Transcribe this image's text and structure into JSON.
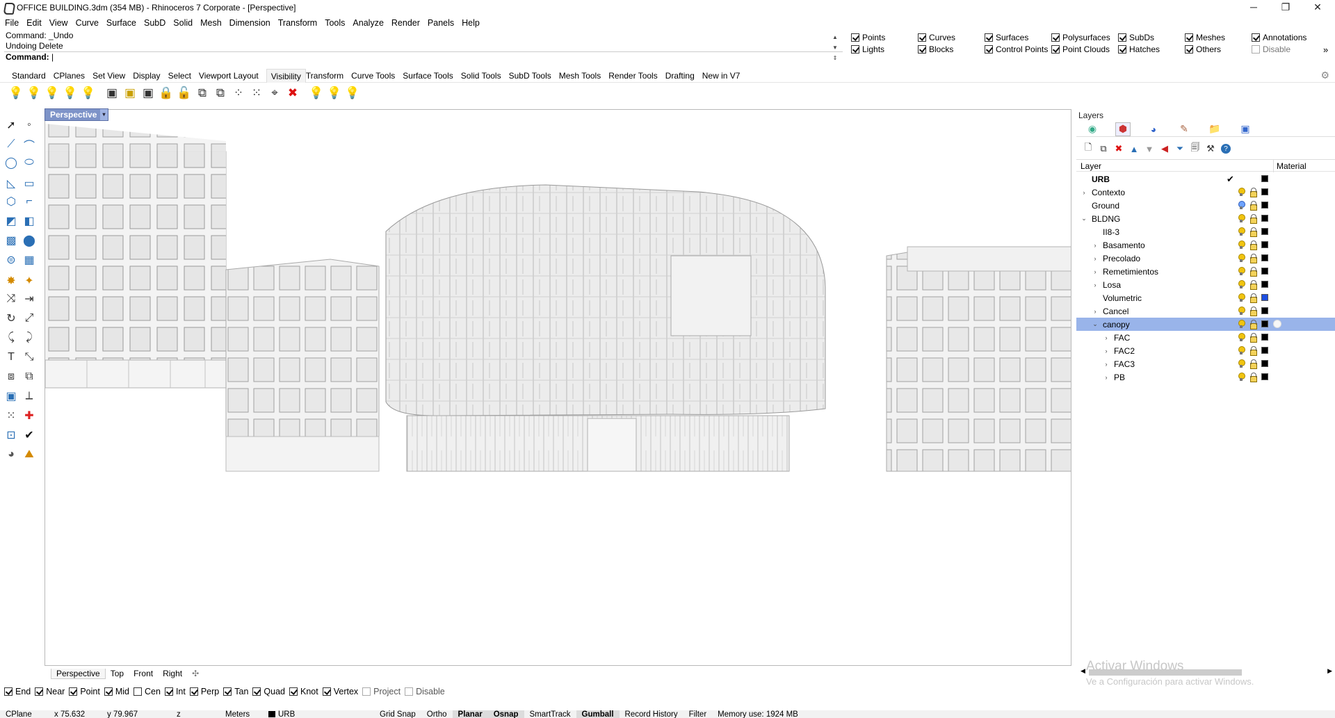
{
  "window": {
    "title": "OFFICE BUILDING.3dm (354 MB) - Rhinoceros 7 Corporate - [Perspective]",
    "minimize": "─",
    "maximize": "❐",
    "close": "✕"
  },
  "menu": [
    "File",
    "Edit",
    "View",
    "Curve",
    "Surface",
    "SubD",
    "Solid",
    "Mesh",
    "Dimension",
    "Transform",
    "Tools",
    "Analyze",
    "Render",
    "Panels",
    "Help"
  ],
  "command": {
    "history": [
      "Command: _Undo",
      "Undoing Delete"
    ],
    "prompt": "Command:"
  },
  "filters": [
    {
      "label": "Points",
      "checked": true
    },
    {
      "label": "Curves",
      "checked": true
    },
    {
      "label": "Surfaces",
      "checked": true
    },
    {
      "label": "Polysurfaces",
      "checked": true
    },
    {
      "label": "SubDs",
      "checked": true
    },
    {
      "label": "Meshes",
      "checked": true
    },
    {
      "label": "Annotations",
      "checked": true
    },
    {
      "label": "Lights",
      "checked": true
    },
    {
      "label": "Blocks",
      "checked": true
    },
    {
      "label": "Control Points",
      "checked": true
    },
    {
      "label": "Point Clouds",
      "checked": true
    },
    {
      "label": "Hatches",
      "checked": true
    },
    {
      "label": "Others",
      "checked": true
    },
    {
      "label": "Disable",
      "checked": false
    }
  ],
  "filters_more": "»",
  "toolbar_tabs": [
    "Standard",
    "CPlanes",
    "Set View",
    "Display",
    "Select",
    "Viewport Layout",
    "Visibility",
    "Transform",
    "Curve Tools",
    "Surface Tools",
    "Solid Tools",
    "SubD Tools",
    "Mesh Tools",
    "Render Tools",
    "Drafting",
    "New in V7"
  ],
  "active_tab": "Visibility",
  "viewport": {
    "title": "Perspective",
    "dropdown": "▾",
    "tabs": [
      "Perspective",
      "Top",
      "Front",
      "Right"
    ],
    "add_tab": "✣"
  },
  "osnaps": [
    {
      "label": "End",
      "checked": true
    },
    {
      "label": "Near",
      "checked": true
    },
    {
      "label": "Point",
      "checked": true
    },
    {
      "label": "Mid",
      "checked": true
    },
    {
      "label": "Cen",
      "checked": false
    },
    {
      "label": "Int",
      "checked": true
    },
    {
      "label": "Perp",
      "checked": true
    },
    {
      "label": "Tan",
      "checked": true
    },
    {
      "label": "Quad",
      "checked": true
    },
    {
      "label": "Knot",
      "checked": true
    },
    {
      "label": "Vertex",
      "checked": true
    },
    {
      "label": "Project",
      "checked": false
    },
    {
      "label": "Disable",
      "checked": false
    }
  ],
  "status": {
    "cplane": "CPlane",
    "x": "x 75.632",
    "y": "y 79.967",
    "z": "z",
    "units": "Meters",
    "layer": "URB",
    "grid_snap": "Grid Snap",
    "ortho": "Ortho",
    "planar": "Planar",
    "osnap": "Osnap",
    "smarttrack": "SmartTrack",
    "gumball": "Gumball",
    "record_history": "Record History",
    "filter": "Filter",
    "memory": "Memory use: 1924 MB"
  },
  "layers_panel": {
    "title": "Layers",
    "col_layer": "Layer",
    "col_material": "Material",
    "current_check": "✔",
    "rows": [
      {
        "name": "URB",
        "indent": 0,
        "arrow": "",
        "bold": true,
        "current": true,
        "color": "#000000",
        "bulb": "none",
        "selected": false
      },
      {
        "name": "Contexto",
        "indent": 0,
        "arrow": "›",
        "bold": false,
        "current": false,
        "color": "#000000",
        "bulb": "on",
        "selected": false
      },
      {
        "name": "Ground",
        "indent": 0,
        "arrow": "",
        "bold": false,
        "current": false,
        "color": "#000000",
        "bulb": "blue",
        "selected": false
      },
      {
        "name": "BLDNG",
        "indent": 0,
        "arrow": "⌄",
        "bold": false,
        "current": false,
        "color": "#000000",
        "bulb": "on",
        "selected": false
      },
      {
        "name": "II8-3",
        "indent": 1,
        "arrow": "",
        "bold": false,
        "current": false,
        "color": "#000000",
        "bulb": "on",
        "selected": false
      },
      {
        "name": "Basamento",
        "indent": 1,
        "arrow": "›",
        "bold": false,
        "current": false,
        "color": "#000000",
        "bulb": "on",
        "selected": false
      },
      {
        "name": "Precolado",
        "indent": 1,
        "arrow": "›",
        "bold": false,
        "current": false,
        "color": "#000000",
        "bulb": "on",
        "selected": false
      },
      {
        "name": "Remetimientos",
        "indent": 1,
        "arrow": "›",
        "bold": false,
        "current": false,
        "color": "#000000",
        "bulb": "on",
        "selected": false
      },
      {
        "name": "Losa",
        "indent": 1,
        "arrow": "›",
        "bold": false,
        "current": false,
        "color": "#000000",
        "bulb": "on",
        "selected": false
      },
      {
        "name": "Volumetric",
        "indent": 1,
        "arrow": "",
        "bold": false,
        "current": false,
        "color": "#1f4fe0",
        "bulb": "on",
        "selected": false
      },
      {
        "name": "Cancel",
        "indent": 1,
        "arrow": "›",
        "bold": false,
        "current": false,
        "color": "#000000",
        "bulb": "on",
        "selected": false
      },
      {
        "name": "canopy",
        "indent": 1,
        "arrow": "⌄",
        "bold": false,
        "current": false,
        "color": "#000000",
        "bulb": "on",
        "selected": true
      },
      {
        "name": "FAC",
        "indent": 2,
        "arrow": "›",
        "bold": false,
        "current": false,
        "color": "#000000",
        "bulb": "on",
        "selected": false
      },
      {
        "name": "FAC2",
        "indent": 2,
        "arrow": "›",
        "bold": false,
        "current": false,
        "color": "#000000",
        "bulb": "on",
        "selected": false
      },
      {
        "name": "FAC3",
        "indent": 2,
        "arrow": "›",
        "bold": false,
        "current": false,
        "color": "#000000",
        "bulb": "on",
        "selected": false
      },
      {
        "name": "PB",
        "indent": 2,
        "arrow": "›",
        "bold": false,
        "current": false,
        "color": "#000000",
        "bulb": "on",
        "selected": false
      }
    ]
  },
  "watermark": {
    "line1": "Activar Windows",
    "line2": "Ve a Configuración para activar Windows."
  }
}
